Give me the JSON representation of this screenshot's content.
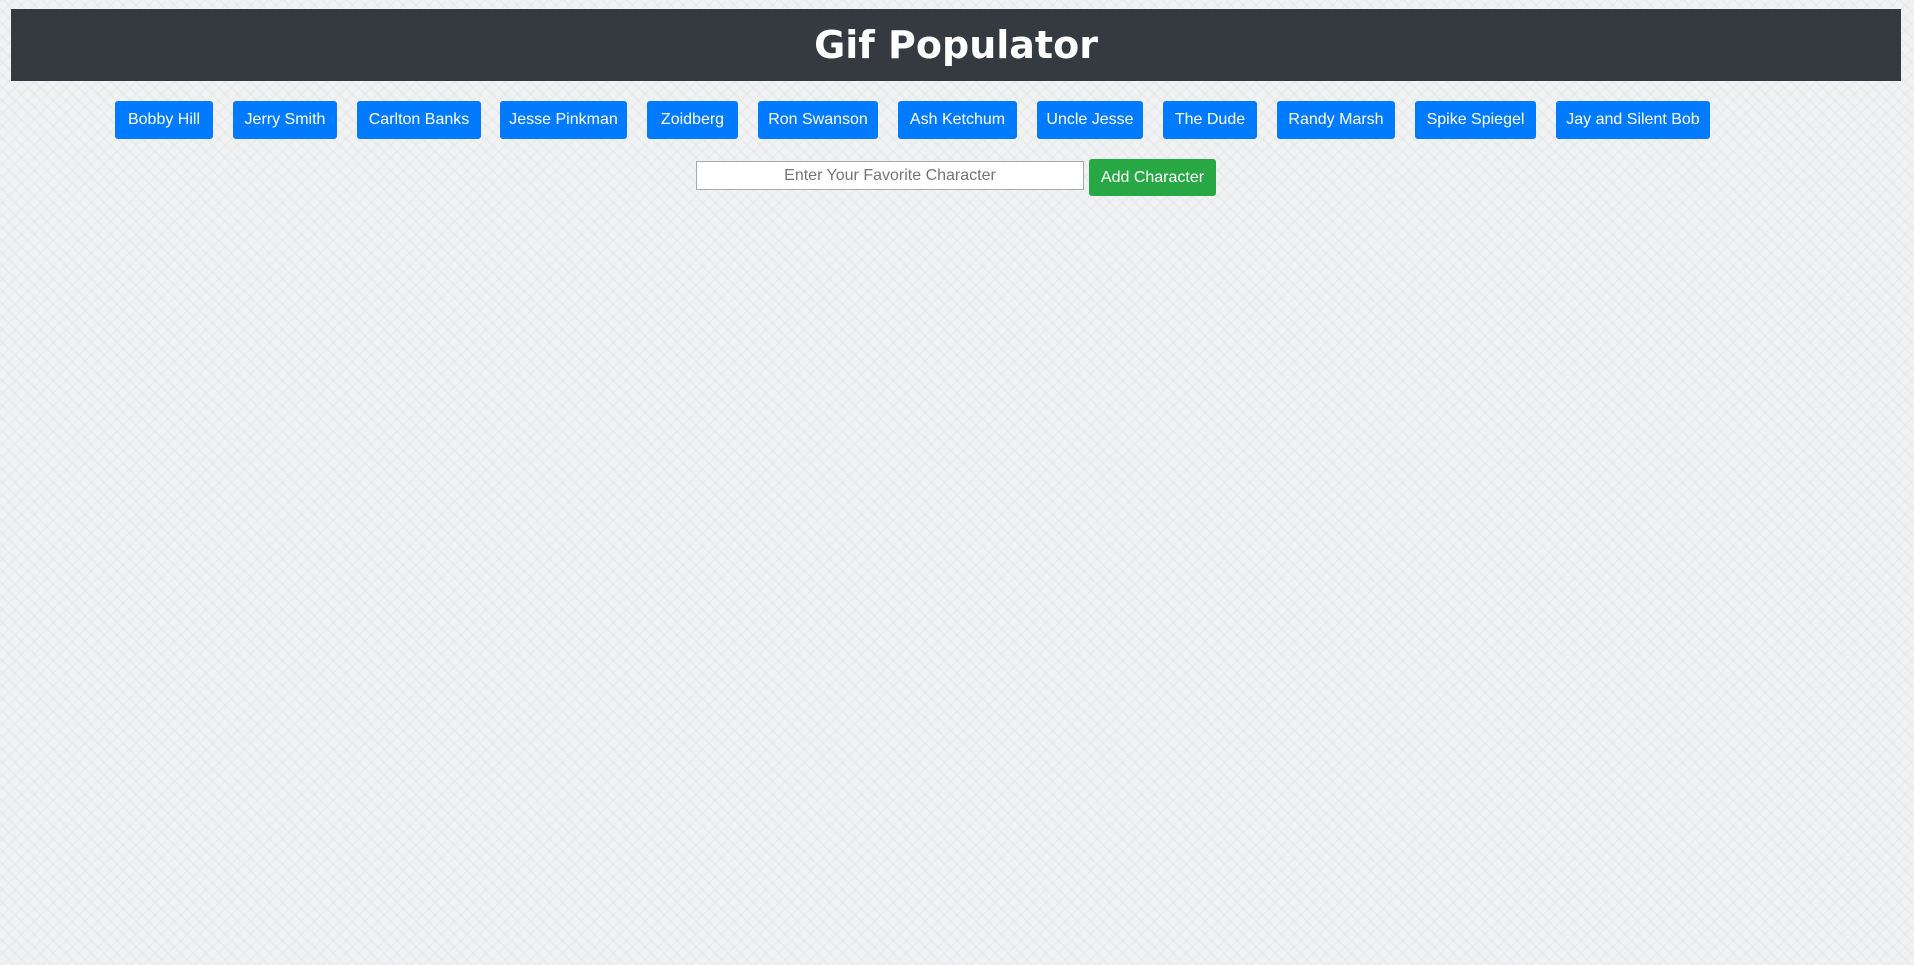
{
  "header": {
    "title": "Gif Populator"
  },
  "characters": [
    "Bobby Hill",
    "Jerry Smith",
    "Carlton Banks",
    "Jesse Pinkman",
    "Zoidberg",
    "Ron Swanson",
    "Ash Ketchum",
    "Uncle Jesse",
    "The Dude",
    "Randy Marsh",
    "Spike Spiegel",
    "Jay and Silent Bob"
  ],
  "form": {
    "input_value": "",
    "input_placeholder": "Enter Your Favorite Character",
    "add_label": "Add Character"
  },
  "colors": {
    "header_bg": "#343a40",
    "primary": "#007bff",
    "success": "#28a745",
    "page_bg": "#f1f2f4"
  }
}
